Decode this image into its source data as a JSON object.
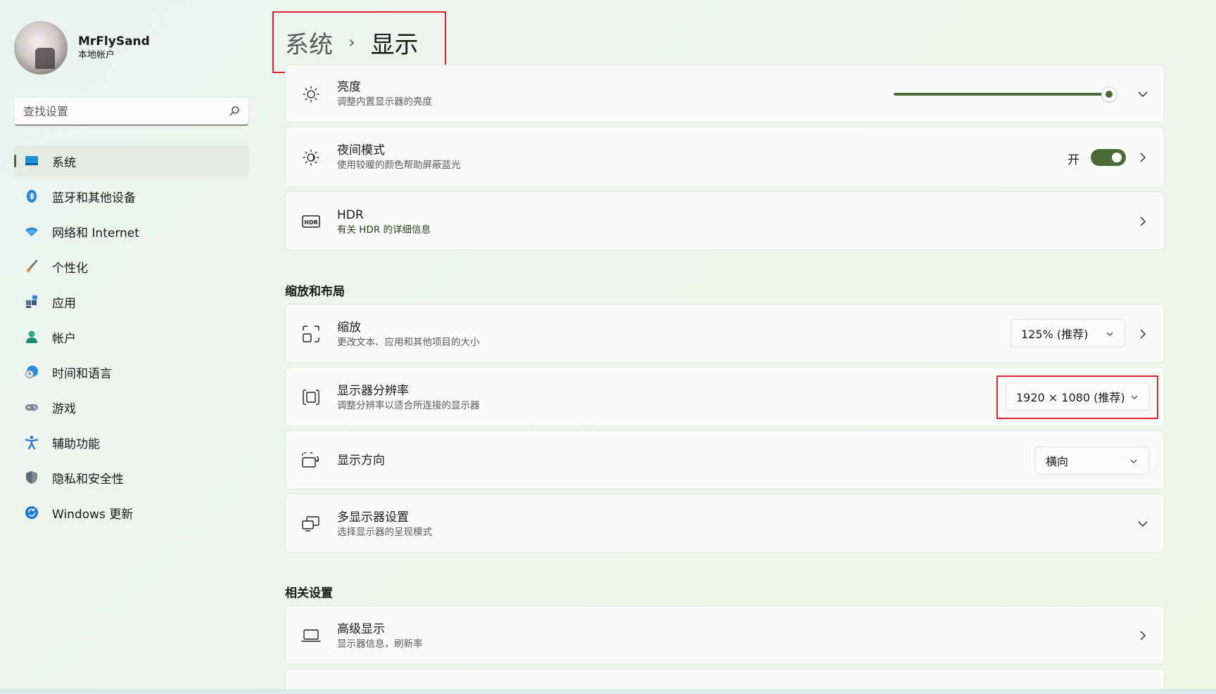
{
  "profile": {
    "name": "MrFlySand",
    "account_type": "本地帐户"
  },
  "search": {
    "placeholder": "查找设置"
  },
  "sidebar": {
    "items": [
      {
        "label": "系统",
        "icon": "monitor-icon",
        "active": true
      },
      {
        "label": "蓝牙和其他设备",
        "icon": "bluetooth-icon"
      },
      {
        "label": "网络和 Internet",
        "icon": "wifi-icon"
      },
      {
        "label": "个性化",
        "icon": "brush-icon"
      },
      {
        "label": "应用",
        "icon": "apps-icon"
      },
      {
        "label": "帐户",
        "icon": "person-icon"
      },
      {
        "label": "时间和语言",
        "icon": "globe-clock-icon"
      },
      {
        "label": "游戏",
        "icon": "gamepad-icon"
      },
      {
        "label": "辅助功能",
        "icon": "accessibility-icon"
      },
      {
        "label": "隐私和安全性",
        "icon": "shield-icon"
      },
      {
        "label": "Windows 更新",
        "icon": "update-icon"
      }
    ]
  },
  "breadcrumb": {
    "parent": "系统",
    "separator": "›",
    "current": "显示"
  },
  "display": {
    "brightness": {
      "title": "亮度",
      "desc": "调整内置显示器的亮度",
      "level": 1.0
    },
    "night_light": {
      "title": "夜间模式",
      "desc": "使用较暖的颜色帮助屏蔽蓝光",
      "state_label": "开",
      "on": true
    },
    "hdr": {
      "title": "HDR",
      "desc": "有关 HDR 的详细信息"
    }
  },
  "scale_layout": {
    "section_title": "缩放和布局",
    "scale": {
      "title": "缩放",
      "desc": "更改文本、应用和其他项目的大小",
      "value": "125% (推荐)"
    },
    "resolution": {
      "title": "显示器分辨率",
      "desc": "调整分辨率以适合所连接的显示器",
      "value": "1920 × 1080 (推荐)"
    },
    "orientation": {
      "title": "显示方向",
      "value": "横向"
    },
    "multi_display": {
      "title": "多显示器设置",
      "desc": "选择显示器的呈现模式"
    }
  },
  "related": {
    "section_title": "相关设置",
    "advanced": {
      "title": "高级显示",
      "desc": "显示器信息，刷新率"
    }
  },
  "colors": {
    "accent": "#4a6a38",
    "highlight": "#e0202e"
  }
}
